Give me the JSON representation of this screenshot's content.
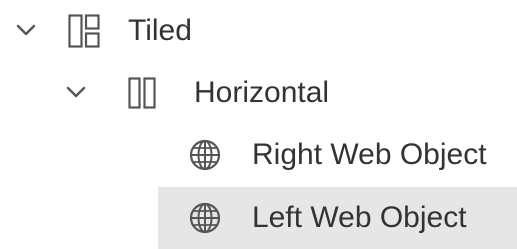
{
  "tree": {
    "nodes": [
      {
        "label": "Tiled",
        "icon": "tiled-container-icon",
        "expanded": true,
        "level": 0
      },
      {
        "label": "Horizontal",
        "icon": "horizontal-container-icon",
        "expanded": true,
        "level": 1
      },
      {
        "label": "Right Web Object",
        "icon": "globe-icon",
        "level": 2
      },
      {
        "label": "Left Web Object",
        "icon": "globe-icon",
        "level": 2,
        "selected": true
      }
    ]
  },
  "colors": {
    "text": "#333333",
    "icon": "#555555",
    "selected_background": "#e6e6e6"
  }
}
